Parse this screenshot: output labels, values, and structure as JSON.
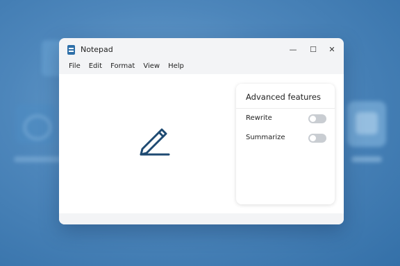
{
  "window": {
    "title": "Notepad",
    "controls": {
      "minimize": "—",
      "maximize": "☐",
      "close": "✕"
    }
  },
  "menu": [
    "File",
    "Edit",
    "Format",
    "View",
    "Help"
  ],
  "panel": {
    "title": "Advanced features",
    "options": [
      {
        "label": "Rewrite",
        "enabled": false
      },
      {
        "label": "Summarize",
        "enabled": false
      }
    ]
  },
  "icons": {
    "app": "notepad-icon",
    "editor": "pencil-icon"
  },
  "colors": {
    "accent": "#1e4a72",
    "toggle_off": "#c9cdd2"
  }
}
